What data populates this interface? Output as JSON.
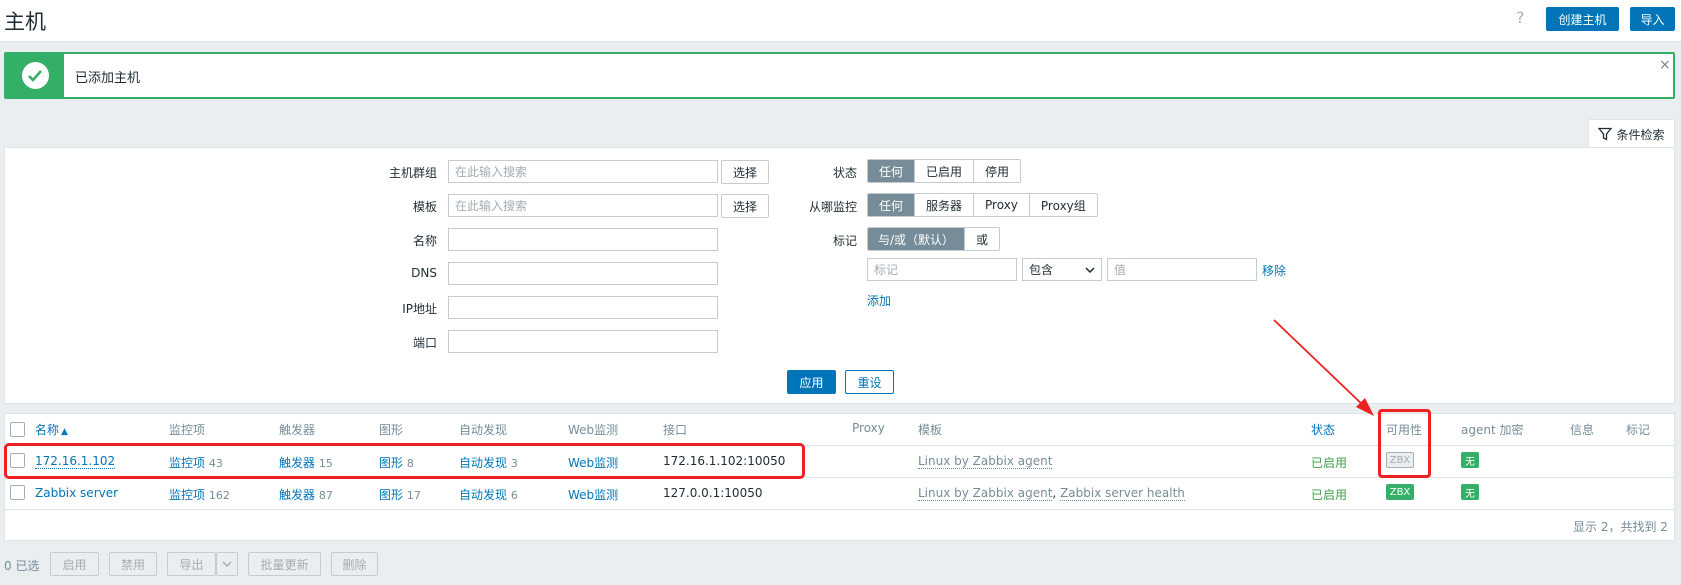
{
  "header": {
    "title": "主机",
    "help": "?",
    "create_button": "创建主机",
    "import_button": "导入"
  },
  "message": {
    "text": "已添加主机",
    "close": "×"
  },
  "filter_tab": {
    "label": "条件检索"
  },
  "filter": {
    "host_group": {
      "label": "主机群组",
      "placeholder": "在此输入搜索",
      "button": "选择"
    },
    "template": {
      "label": "模板",
      "placeholder": "在此输入搜索",
      "button": "选择"
    },
    "name": {
      "label": "名称",
      "value": ""
    },
    "dns": {
      "label": "DNS",
      "value": ""
    },
    "ip": {
      "label": "IP地址",
      "value": ""
    },
    "port": {
      "label": "端口",
      "value": ""
    },
    "status": {
      "label": "状态",
      "options": [
        "任何",
        "已启用",
        "停用"
      ],
      "selected": "任何"
    },
    "monitored_by": {
      "label": "从哪监控",
      "options": [
        "任何",
        "服务器",
        "Proxy",
        "Proxy组"
      ],
      "selected": "任何"
    },
    "tags": {
      "label": "标记",
      "options": [
        "与/或（默认）",
        "或"
      ],
      "selected": "与/或（默认）",
      "tag_placeholder": "标记",
      "operator": "包含",
      "value_placeholder": "值",
      "remove": "移除",
      "add": "添加"
    },
    "apply_button": "应用",
    "reset_button": "重设"
  },
  "table": {
    "columns": {
      "name": "名称",
      "items": "监控项",
      "triggers": "触发器",
      "graphs": "图形",
      "discovery": "自动发现",
      "web": "Web监测",
      "interface": "接口",
      "proxy": "Proxy",
      "templates": "模板",
      "status": "状态",
      "availability": "可用性",
      "agent_encryption": "agent 加密",
      "info": "信息",
      "tags": "标记"
    },
    "rows": [
      {
        "name": "172.16.1.102",
        "items_label": "监控项",
        "items_count": "43",
        "triggers_label": "触发器",
        "triggers_count": "15",
        "graphs_label": "图形",
        "graphs_count": "8",
        "discovery_label": "自动发现",
        "discovery_count": "3",
        "web": "Web监测",
        "interface": "172.16.1.102:10050",
        "template1": "Linux by Zabbix agent",
        "template_sep": "",
        "template2": "",
        "status": "已启用",
        "availability": "ZBX",
        "encryption": "无"
      },
      {
        "name": "Zabbix server",
        "items_label": "监控项",
        "items_count": "162",
        "triggers_label": "触发器",
        "triggers_count": "87",
        "graphs_label": "图形",
        "graphs_count": "17",
        "discovery_label": "自动发现",
        "discovery_count": "6",
        "web": "Web监测",
        "interface": "127.0.0.1:10050",
        "template1": "Linux by Zabbix agent",
        "template_sep": ",",
        "template2": "Zabbix server health",
        "status": "已启用",
        "availability": "ZBX",
        "encryption": "无"
      }
    ],
    "summary": "显示 2，共找到 2"
  },
  "bulk": {
    "selected": "0 已选",
    "enable": "启用",
    "disable": "禁用",
    "export": "导出",
    "mass_update": "批量更新",
    "delete": "删除"
  },
  "colors": {
    "accent": "#0275b8",
    "success": "#34af67",
    "highlight": "#ee2222"
  }
}
